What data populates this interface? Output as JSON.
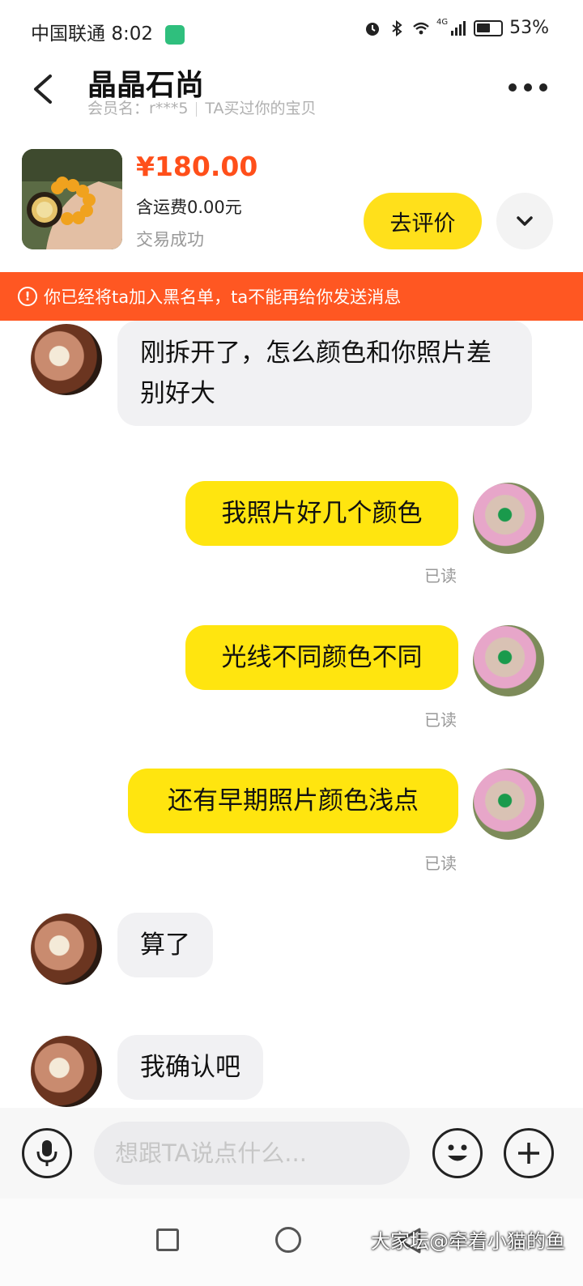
{
  "status_bar": {
    "carrier": "中国联通",
    "time": "8:02",
    "network": "4G",
    "battery": "53%"
  },
  "header": {
    "title": "晶晶石尚",
    "member_label": "会员名：",
    "member_name": "r***5",
    "bought_note": "TA买过你的宝贝"
  },
  "product": {
    "price": "¥180.00",
    "shipping": "含运费0.00元",
    "status": "交易成功",
    "review_button": "去评价"
  },
  "banner": {
    "icon": "!",
    "text": "你已经将ta加入黑名单，ta不能再给你发送消息"
  },
  "messages": [
    {
      "side": "left",
      "text": "刚拆开了，怎么颜色和你照片差别好大"
    },
    {
      "side": "right",
      "text": "我照片好几个颜色",
      "read": "已读"
    },
    {
      "side": "right",
      "text": "光线不同颜色不同",
      "read": "已读"
    },
    {
      "side": "right",
      "text": "还有早期照片颜色浅点",
      "read": "已读"
    },
    {
      "side": "left",
      "text": "算了"
    },
    {
      "side": "left",
      "text": "我确认吧"
    }
  ],
  "input": {
    "placeholder": "想跟TA说点什么..."
  },
  "watermark": "大家坛@牵着小猫的鱼",
  "colors": {
    "accent_yellow": "#ffe50f",
    "banner_orange": "#ff5722",
    "price_red": "#ff4f1a"
  },
  "icons": [
    "back-arrow-icon",
    "more-dots-icon",
    "chevron-down-icon",
    "warning-icon",
    "microphone-icon",
    "emoji-icon",
    "plus-icon"
  ]
}
